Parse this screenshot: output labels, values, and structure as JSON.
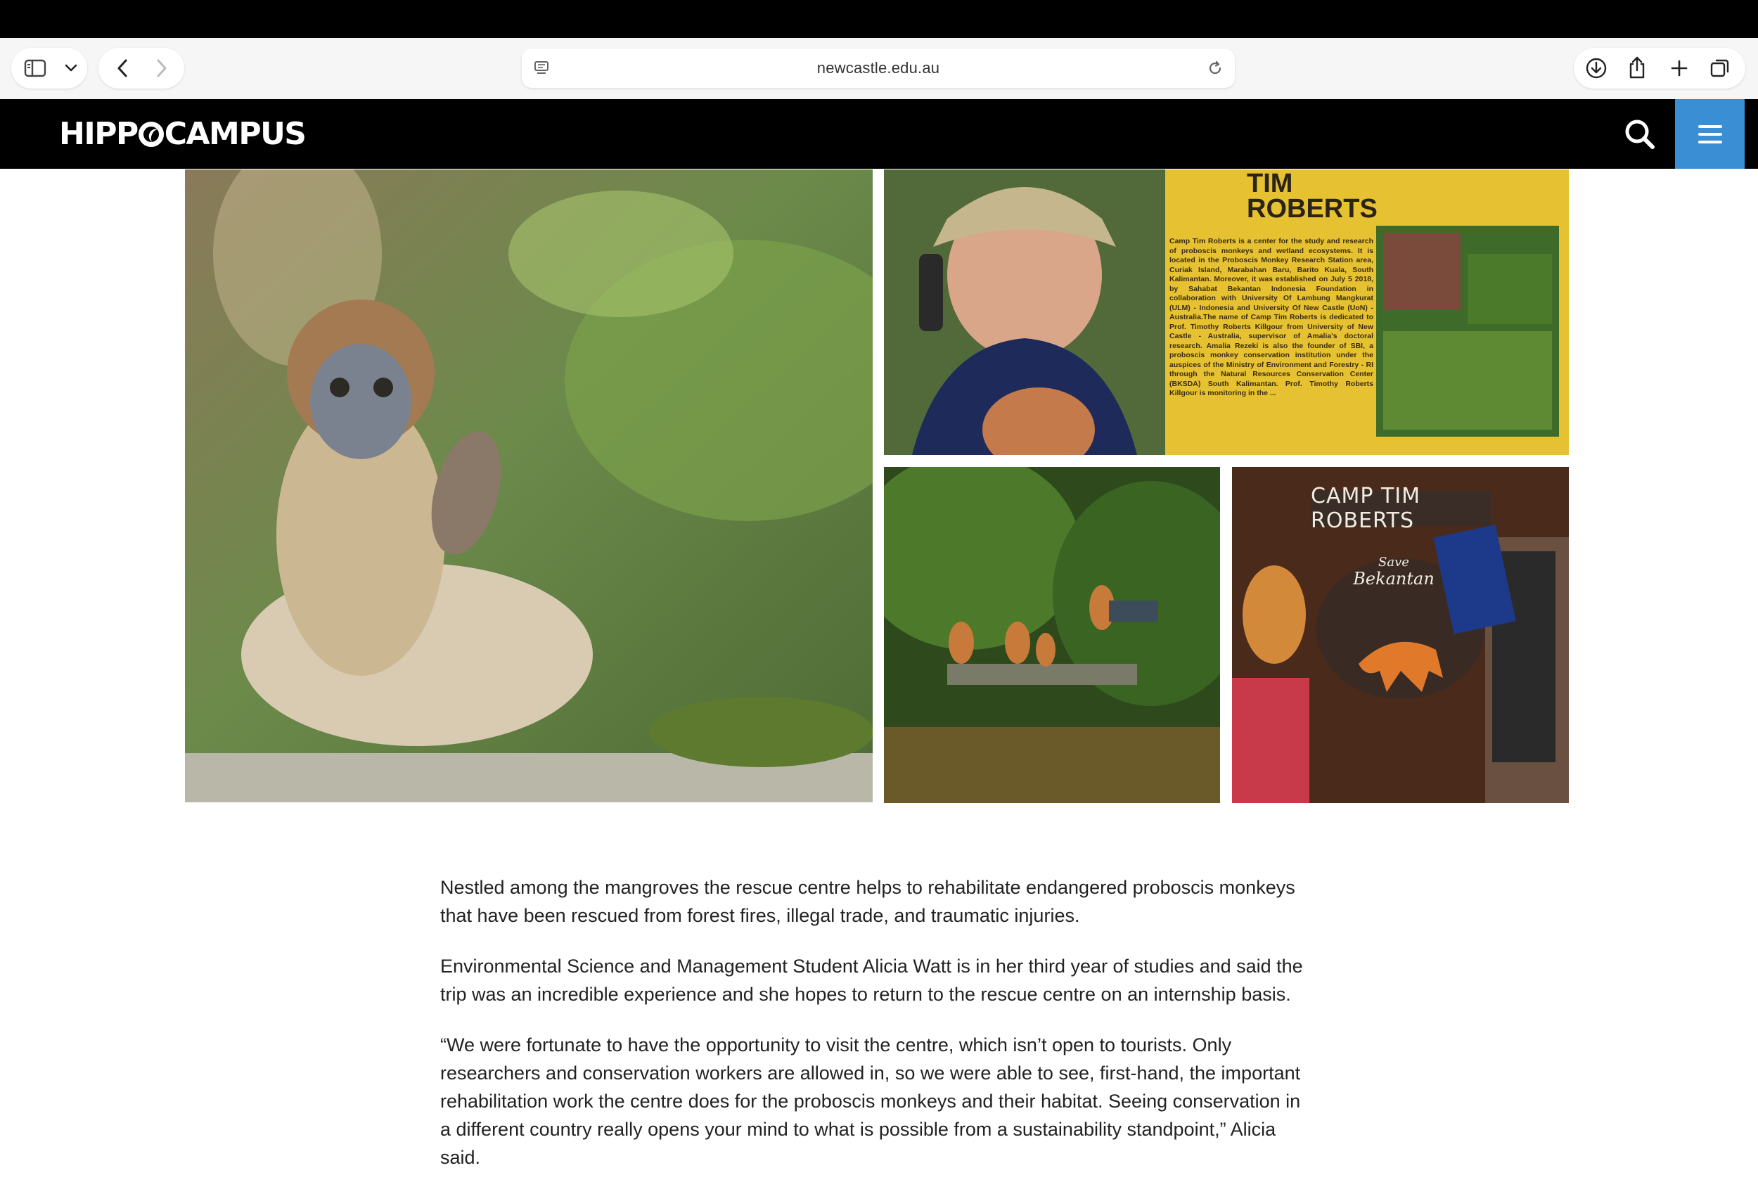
{
  "browser": {
    "url": "newcastle.edu.au"
  },
  "site": {
    "logo": "HIPPOCAMPUS",
    "logo_prefix": "HIPP",
    "logo_suffix": "CAMPUS"
  },
  "gallery": {
    "sign_title_line1": "TIM",
    "sign_title_line2": "ROBERTS",
    "sign_body": "Camp Tim Roberts is a center for the study and research of proboscis monkeys and wetland ecosystems. It is located in the Proboscis Monkey Research Station area, Curiak Island, Marabahan Baru, Barito Kuala, South Kalimantan. Moreover, it was established on July 5 2018, by Sahabat Bekantan Indonesia Foundation in collaboration with University Of Lambung Mangkurat (ULM) - Indonesia and University Of New Castle (UoN) - Australia.The name of Camp Tim Roberts is dedicated to Prof. Timothy Roberts Killgour from University of New Castle - Australia, supervisor of Amalia's doctoral research. Amalia Rezeki is also the founder of SBI, a proboscis monkey conservation institution under the auspices of the Ministry of Environment and Forestry - RI through the Natural Resources Conservation Center (BKSDA) South Kalimantan. Prof. Timothy Roberts Killgour is monitoring in the ...",
    "camp_sign": "CAMP TIM ROBERTS",
    "save_label": "Save",
    "bekantan_label": "Bekantan"
  },
  "article": {
    "paragraphs": [
      "Nestled among the mangroves the rescue centre helps to rehabilitate endangered proboscis monkeys that have been rescued from forest fires, illegal trade, and traumatic injuries.",
      "Environmental Science and Management Student Alicia Watt is in her third year of studies and said the trip was an incredible experience and she hopes to return to the rescue centre on an internship basis.",
      "“We were fortunate to have the opportunity to visit the centre, which isn’t open to tourists. Only researchers and conservation workers are allowed in, so we were able to see, first-hand, the important rehabilitation work the centre does for the proboscis monkeys and their habitat. Seeing conservation in a different country really opens your mind to what is possible from a sustainability standpoint,” Alicia said."
    ]
  }
}
